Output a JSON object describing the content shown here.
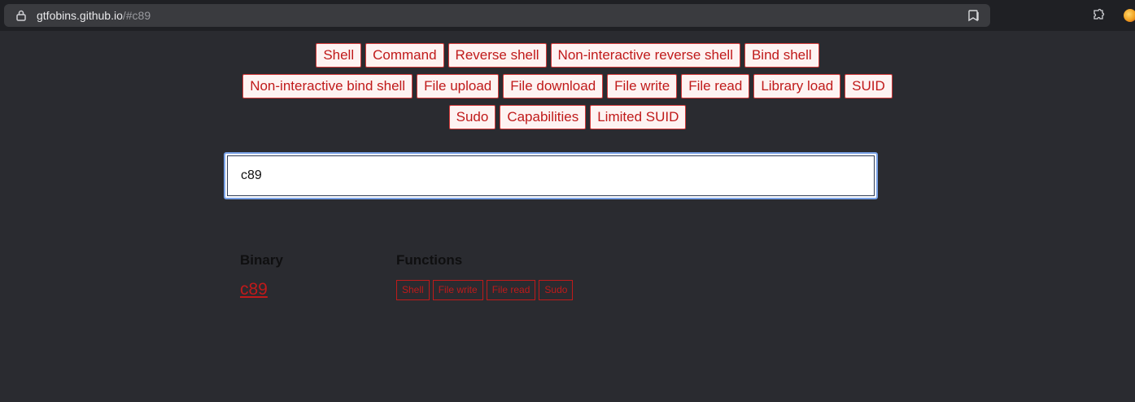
{
  "browser": {
    "url_host": "gtfobins.github.io",
    "url_path": "/#c89"
  },
  "filters": {
    "rows": [
      [
        "Shell",
        "Command",
        "Reverse shell",
        "Non-interactive reverse shell",
        "Bind shell"
      ],
      [
        "Non-interactive bind shell",
        "File upload",
        "File download",
        "File write",
        "File read",
        "Library load",
        "SUID"
      ],
      [
        "Sudo",
        "Capabilities",
        "Limited SUID"
      ]
    ]
  },
  "search": {
    "value": "c89"
  },
  "results": {
    "binary_header": "Binary",
    "functions_header": "Functions",
    "rows": [
      {
        "binary": "c89",
        "functions": [
          "Shell",
          "File write",
          "File read",
          "Sudo"
        ]
      }
    ]
  },
  "colors": {
    "accent": "#c01a1a",
    "background": "#2a2b30"
  }
}
